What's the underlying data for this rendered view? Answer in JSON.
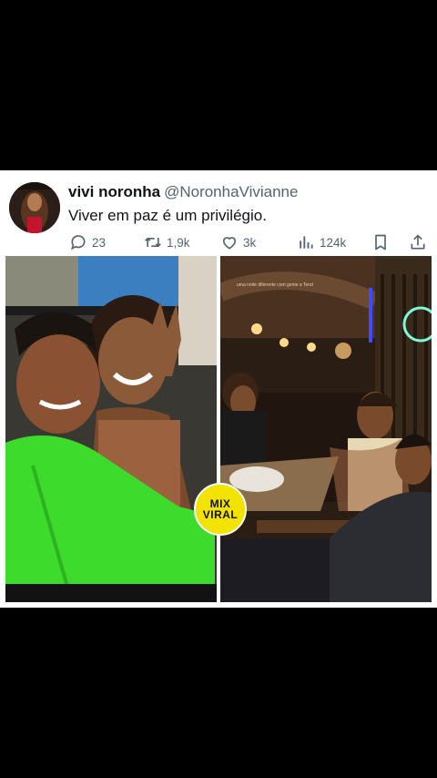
{
  "tweet": {
    "display_name": "vivi noronha",
    "handle": "@NoronhaVivianne",
    "text": "Viver em paz é um privilégio."
  },
  "actions": {
    "replies": "23",
    "retweets": "1,9k",
    "likes": "3k",
    "views": "124k"
  },
  "photo2": {
    "sign_text": "uma noite diferente com gente a Tend"
  },
  "watermark": {
    "line1": "MIX",
    "line2": "VIRAL"
  },
  "colors": {
    "background": "#000000",
    "card": "#ffffff",
    "muted_text": "#536471",
    "badge": "#f2e300"
  }
}
